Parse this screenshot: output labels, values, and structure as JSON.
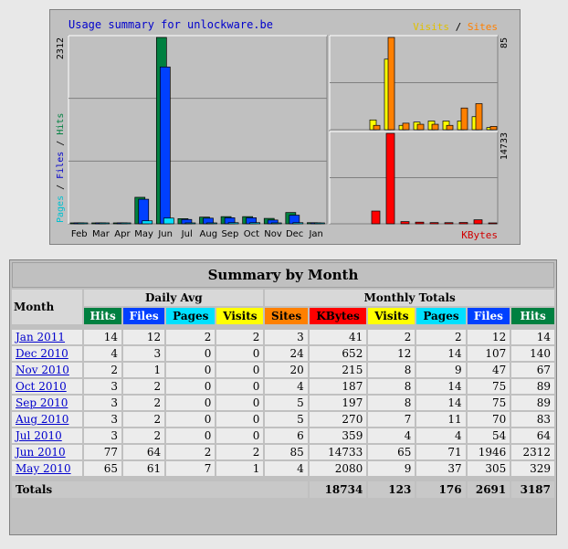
{
  "chart_data": {
    "type": "bar",
    "title": "Usage summary for unlockware.be",
    "categories": [
      "Feb",
      "Mar",
      "Apr",
      "May",
      "Jun",
      "Jul",
      "Aug",
      "Sep",
      "Oct",
      "Nov",
      "Dec",
      "Jan"
    ],
    "left_panel": {
      "ylabel_parts": [
        "Pages",
        "Files",
        "Hits"
      ],
      "ymax_label": "2312",
      "ymax": 2312,
      "series": [
        {
          "name": "Hits",
          "color": "#008040",
          "values": [
            0,
            0,
            0,
            329,
            2312,
            64,
            83,
            89,
            89,
            67,
            140,
            14
          ]
        },
        {
          "name": "Files",
          "color": "#0040ff",
          "values": [
            0,
            0,
            0,
            305,
            1946,
            54,
            70,
            75,
            75,
            47,
            107,
            12
          ]
        },
        {
          "name": "Pages",
          "color": "#00e0ff",
          "values": [
            0,
            0,
            0,
            37,
            71,
            4,
            11,
            14,
            14,
            9,
            14,
            2
          ]
        }
      ]
    },
    "right_top_panel": {
      "legend_parts": [
        "Visits",
        "Sites"
      ],
      "ymax_label": "85",
      "ymax": 85,
      "series": [
        {
          "name": "Visits",
          "color": "#ffff00",
          "values": [
            9,
            65,
            4,
            7,
            8,
            8,
            8,
            12,
            2
          ]
        },
        {
          "name": "Sites",
          "color": "#ff8000",
          "values": [
            4,
            85,
            6,
            5,
            5,
            4,
            20,
            24,
            3
          ]
        }
      ]
    },
    "right_bottom_panel": {
      "legend": "KBytes",
      "ymax_label": "14733",
      "ymax": 14733,
      "series": [
        {
          "name": "KBytes",
          "color": "#ff0000",
          "values": [
            2080,
            14733,
            359,
            270,
            197,
            187,
            215,
            652,
            41
          ]
        }
      ]
    }
  },
  "summary": {
    "title": "Summary by Month",
    "month_header": "Month",
    "daily_avg_header": "Daily Avg",
    "monthly_totals_header": "Monthly Totals",
    "daily_cols": [
      {
        "label": "Hits",
        "color": "#008040",
        "light": true
      },
      {
        "label": "Files",
        "color": "#0040ff",
        "light": true
      },
      {
        "label": "Pages",
        "color": "#00e0ff",
        "light": false
      },
      {
        "label": "Visits",
        "color": "#ffff00",
        "light": false
      }
    ],
    "monthly_cols": [
      {
        "label": "Sites",
        "color": "#ff8000",
        "light": false
      },
      {
        "label": "KBytes",
        "color": "#ff0000",
        "light": false
      },
      {
        "label": "Visits",
        "color": "#ffff00",
        "light": false
      },
      {
        "label": "Pages",
        "color": "#00e0ff",
        "light": false
      },
      {
        "label": "Files",
        "color": "#0040ff",
        "light": true
      },
      {
        "label": "Hits",
        "color": "#008040",
        "light": true
      }
    ],
    "rows": [
      {
        "month": "Jan 2011",
        "daily": [
          "14",
          "12",
          "2",
          "2"
        ],
        "monthly": [
          "3",
          "41",
          "2",
          "2",
          "12",
          "14"
        ]
      },
      {
        "month": "Dec 2010",
        "daily": [
          "4",
          "3",
          "0",
          "0"
        ],
        "monthly": [
          "24",
          "652",
          "12",
          "14",
          "107",
          "140"
        ]
      },
      {
        "month": "Nov 2010",
        "daily": [
          "2",
          "1",
          "0",
          "0"
        ],
        "monthly": [
          "20",
          "215",
          "8",
          "9",
          "47",
          "67"
        ]
      },
      {
        "month": "Oct 2010",
        "daily": [
          "3",
          "2",
          "0",
          "0"
        ],
        "monthly": [
          "4",
          "187",
          "8",
          "14",
          "75",
          "89"
        ]
      },
      {
        "month": "Sep 2010",
        "daily": [
          "3",
          "2",
          "0",
          "0"
        ],
        "monthly": [
          "5",
          "197",
          "8",
          "14",
          "75",
          "89"
        ]
      },
      {
        "month": "Aug 2010",
        "daily": [
          "3",
          "2",
          "0",
          "0"
        ],
        "monthly": [
          "5",
          "270",
          "7",
          "11",
          "70",
          "83"
        ]
      },
      {
        "month": "Jul 2010",
        "daily": [
          "3",
          "2",
          "0",
          "0"
        ],
        "monthly": [
          "6",
          "359",
          "4",
          "4",
          "54",
          "64"
        ]
      },
      {
        "month": "Jun 2010",
        "daily": [
          "77",
          "64",
          "2",
          "2"
        ],
        "monthly": [
          "85",
          "14733",
          "65",
          "71",
          "1946",
          "2312"
        ]
      },
      {
        "month": "May 2010",
        "daily": [
          "65",
          "61",
          "7",
          "1"
        ],
        "monthly": [
          "4",
          "2080",
          "9",
          "37",
          "305",
          "329"
        ]
      }
    ],
    "totals_label": "Totals",
    "totals": [
      "18734",
      "123",
      "176",
      "2691",
      "3187"
    ]
  }
}
